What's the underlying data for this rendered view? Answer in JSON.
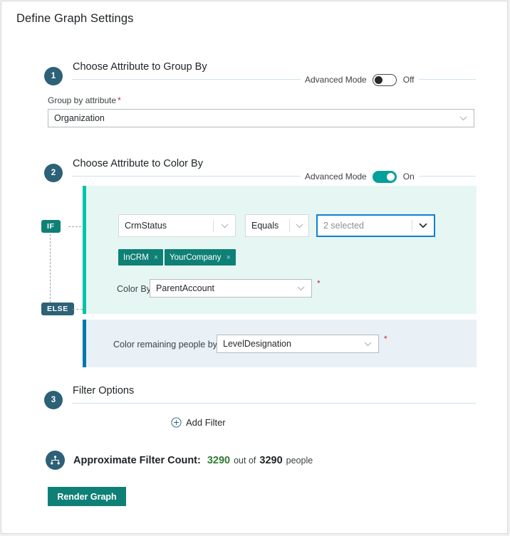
{
  "window": {
    "title": "Define Graph Settings"
  },
  "sections": [
    {
      "number": "1",
      "title": "Choose Attribute to Group By",
      "advanced_label": "Advanced Mode",
      "advanced_state": "Off"
    },
    {
      "number": "2",
      "title": "Choose Attribute to Color By",
      "advanced_label": "Advanced Mode",
      "advanced_state": "On"
    },
    {
      "number": "3",
      "title": "Filter Options"
    }
  ],
  "group_by": {
    "label": "Group by attribute",
    "required_marker": "*",
    "value": "Organization"
  },
  "color_by": {
    "if_badge": "IF",
    "else_badge": "ELSE",
    "condition": {
      "attribute": "CrmStatus",
      "operator": "Equals",
      "values_placeholder": "2 selected",
      "tags": [
        {
          "label": "InCRM",
          "remove": "×"
        },
        {
          "label": "YourCompany",
          "remove": "×"
        }
      ]
    },
    "then": {
      "label": "Color By:",
      "value": "ParentAccount",
      "required_marker": "*"
    },
    "otherwise": {
      "label": "Color remaining people by:",
      "value": "LevelDesignation",
      "required_marker": "*"
    }
  },
  "filters": {
    "add_filter_label": "Add Filter"
  },
  "count": {
    "label": "Approximate Filter Count:",
    "matched": "3290",
    "middle": "out of",
    "total": "3290",
    "suffix": "people"
  },
  "actions": {
    "render_label": "Render Graph"
  },
  "colors": {
    "accent_teal": "#0f8076",
    "accent_dark": "#2c6177",
    "toggle_on": "#00a19b",
    "if_bar": "#00c4a7",
    "else_bar": "#0079a8",
    "focus_blue": "#0f7fd4",
    "count_green": "#2e7d32",
    "required_red": "#c1272d"
  }
}
